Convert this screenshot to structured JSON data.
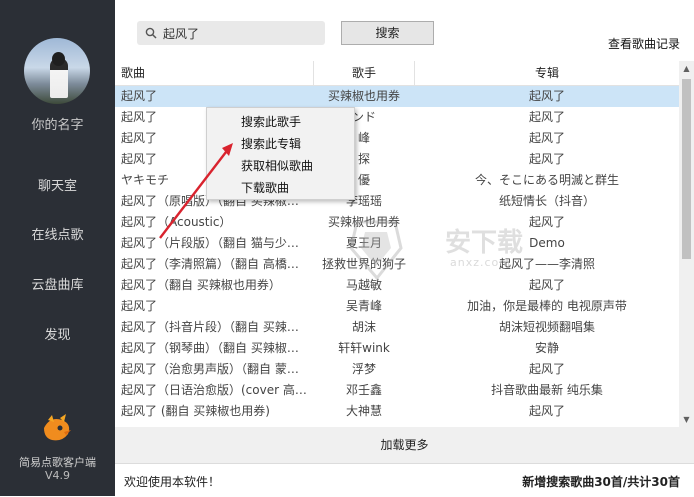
{
  "sidebar": {
    "user_name": "你的名字",
    "nav": [
      "聊天室",
      "在线点歌",
      "云盘曲库",
      "发现"
    ],
    "app_name": "简易点歌客户端",
    "version": "V4.9"
  },
  "search": {
    "value": "起风了",
    "button": "搜索",
    "history": "查看歌曲记录"
  },
  "table": {
    "headers": [
      "歌曲",
      "歌手",
      "专辑"
    ],
    "rows": [
      [
        "起风了",
        "买辣椒也用券",
        "起风了"
      ],
      [
        "起风了",
        "ンド",
        "起风了"
      ],
      [
        "起风了",
        "峰",
        "起风了"
      ],
      [
        "起风了",
        "探",
        "起风了"
      ],
      [
        "ヤキモチ",
        "優",
        "今、そこにある明滅と群生"
      ],
      [
        "起风了（原唱版）（翻自 买辣椒…",
        "李瑶瑶",
        "纸短情长（抖音）"
      ],
      [
        "起风了（Acoustic）",
        "买辣椒也用券",
        "起风了"
      ],
      [
        "起风了（片段版）（翻自 猫与少…",
        "夏王月",
        "Demo"
      ],
      [
        "起风了（李清照篇）（翻自 高橋…",
        "拯救世界的狗子",
        "起风了——李清照"
      ],
      [
        "起风了（翻自 买辣椒也用券）",
        "马越敏",
        "起风了"
      ],
      [
        "起风了",
        "吴青峰",
        "加油，你是最棒的 电视原声带"
      ],
      [
        "起风了（抖音片段）（翻自 买辣…",
        "胡沫",
        "胡沫短视频翻唱集"
      ],
      [
        "起风了（钢琴曲）（翻自 买辣椒…",
        "轩轩wink",
        "安静"
      ],
      [
        "起风了（治愈男声版）（翻自 蒙…",
        "浮梦",
        "起风了"
      ],
      [
        "起风了（日语治愈版）(cover 高…",
        "邓壬鑫",
        "抖音歌曲最新 纯乐集"
      ],
      [
        "起风了 (翻自 买辣椒也用券)",
        "大神慧",
        "起风了"
      ]
    ]
  },
  "context_menu": [
    "搜索此歌手",
    "搜索此专辑",
    "获取相似歌曲",
    "下载歌曲"
  ],
  "load_more": "加载更多",
  "status": {
    "left": "欢迎使用本软件！",
    "right": "新增搜索歌曲30首/共计30首"
  },
  "watermark": {
    "text": "安下载",
    "sub": "anxz.com"
  },
  "colors": {
    "sidebar_bg": "#2b2f36",
    "selected_row": "#cce4f7",
    "arrow": "#d9232e"
  }
}
